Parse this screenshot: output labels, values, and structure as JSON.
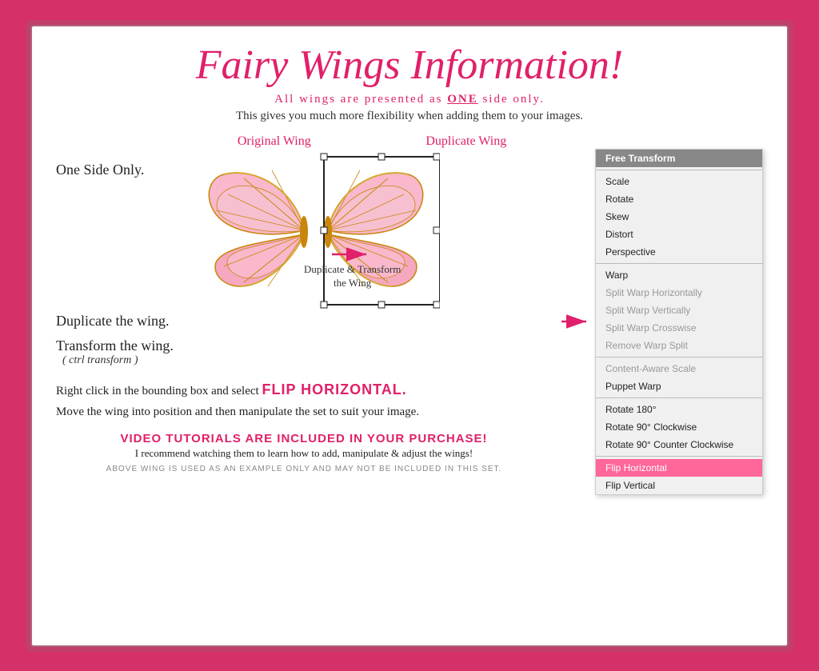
{
  "card": {
    "title": "Fairy Wings Information!",
    "subtitle": "All wings are presented as ONE side only.",
    "description": "This gives you much more flexibility when adding them to your images.",
    "steps": {
      "one_side": "One Side Only.",
      "duplicate": "Duplicate the wing.",
      "transform": "Transform the wing.",
      "ctrl_transform": "( ctrl transform )",
      "flip_instruction": "Right click in the bounding box and select",
      "flip_keyword": "FLIP HORIZONTAL.",
      "move_instruction": "Move the wing into position and then manipulate the set to suit your image.",
      "dup_caption_line1": "Duplicate & Transform",
      "dup_caption_line2": "the Wing"
    },
    "wing_labels": {
      "original": "Original Wing",
      "duplicate": "Duplicate Wing"
    },
    "video": {
      "main": "VIDEO TUTORIALS ARE INCLUDED IN YOUR PURCHASE!",
      "sub": "I recommend watching them to learn how to add, manipulate & adjust the wings!"
    },
    "footer": "ABOVE WING IS USED AS AN EXAMPLE ONLY AND MAY NOT BE INCLUDED IN THIS SET."
  },
  "context_menu": {
    "items": [
      {
        "label": "Free Transform",
        "type": "highlighted"
      },
      {
        "label": "",
        "type": "divider"
      },
      {
        "label": "Scale",
        "type": "normal"
      },
      {
        "label": "Rotate",
        "type": "normal"
      },
      {
        "label": "Skew",
        "type": "normal"
      },
      {
        "label": "Distort",
        "type": "normal"
      },
      {
        "label": "Perspective",
        "type": "normal"
      },
      {
        "label": "",
        "type": "divider"
      },
      {
        "label": "Warp",
        "type": "normal"
      },
      {
        "label": "Split Warp Horizontally",
        "type": "dimmed"
      },
      {
        "label": "Split Warp Vertically",
        "type": "dimmed"
      },
      {
        "label": "Split Warp Crosswise",
        "type": "dimmed"
      },
      {
        "label": "Remove Warp Split",
        "type": "dimmed"
      },
      {
        "label": "",
        "type": "divider"
      },
      {
        "label": "Content-Aware Scale",
        "type": "dimmed"
      },
      {
        "label": "Puppet Warp",
        "type": "normal"
      },
      {
        "label": "",
        "type": "divider"
      },
      {
        "label": "Rotate 180°",
        "type": "normal"
      },
      {
        "label": "Rotate 90° Clockwise",
        "type": "normal"
      },
      {
        "label": "Rotate 90° Counter Clockwise",
        "type": "normal"
      },
      {
        "label": "",
        "type": "divider"
      },
      {
        "label": "Flip Horizontal",
        "type": "active"
      },
      {
        "label": "Flip Vertical",
        "type": "normal"
      }
    ]
  }
}
